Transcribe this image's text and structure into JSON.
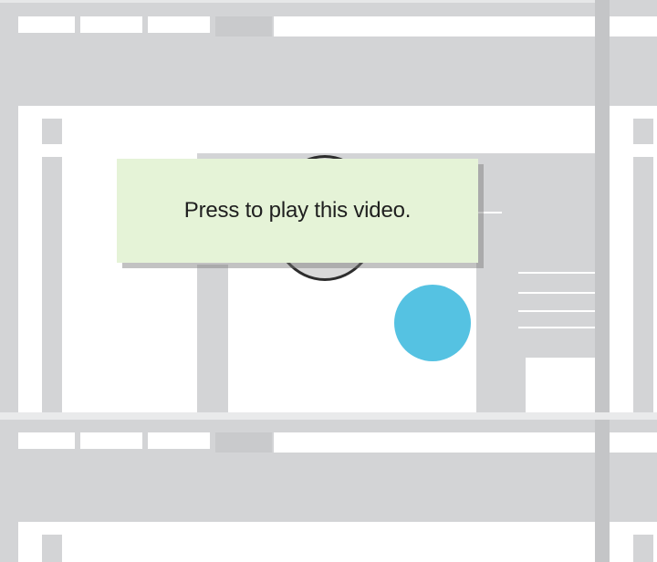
{
  "tooltip": {
    "text": "Press to play this video."
  },
  "colors": {
    "background": "#d3d4d6",
    "panel": "#ffffff",
    "tooltip_bg": "#e5f3d7",
    "cursor_dot": "#55c2e2"
  },
  "icons": {
    "play": "play-circle-icon",
    "cursor": "cursor-dot-icon"
  }
}
